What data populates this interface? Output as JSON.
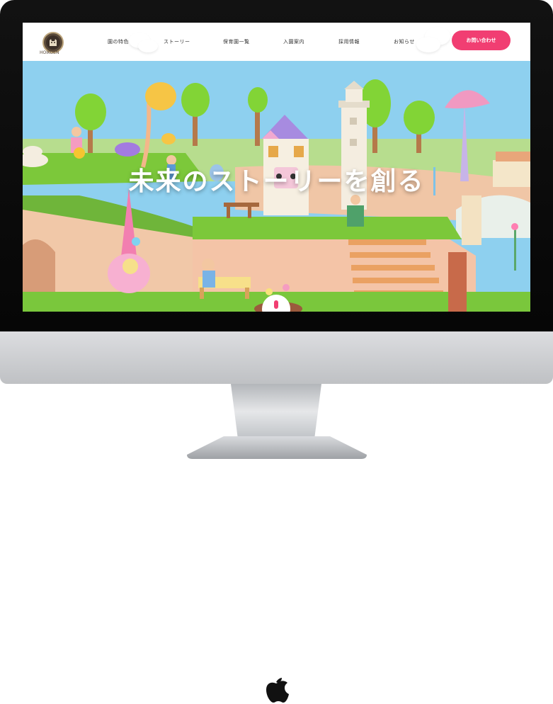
{
  "site": {
    "logo_text": "HOIKUEN",
    "nav": [
      {
        "label": "園の特色"
      },
      {
        "label": "ストーリー"
      },
      {
        "label": "保育園一覧"
      },
      {
        "label": "入園案内"
      },
      {
        "label": "採用情報"
      },
      {
        "label": "お知らせ"
      }
    ],
    "cta_label": "お問い合わせ",
    "headline": "未来のストーリーを創る"
  },
  "colors": {
    "accent": "#f13e72",
    "sky": "#8ed0ef",
    "grass": "#7cc83a",
    "path": "#f0c6a6",
    "bezel": "#0c0c0c",
    "chin": "#c9cbce"
  },
  "icons": {
    "brand": "apple-logo-icon",
    "scroll": "scroll-indicator-icon"
  }
}
